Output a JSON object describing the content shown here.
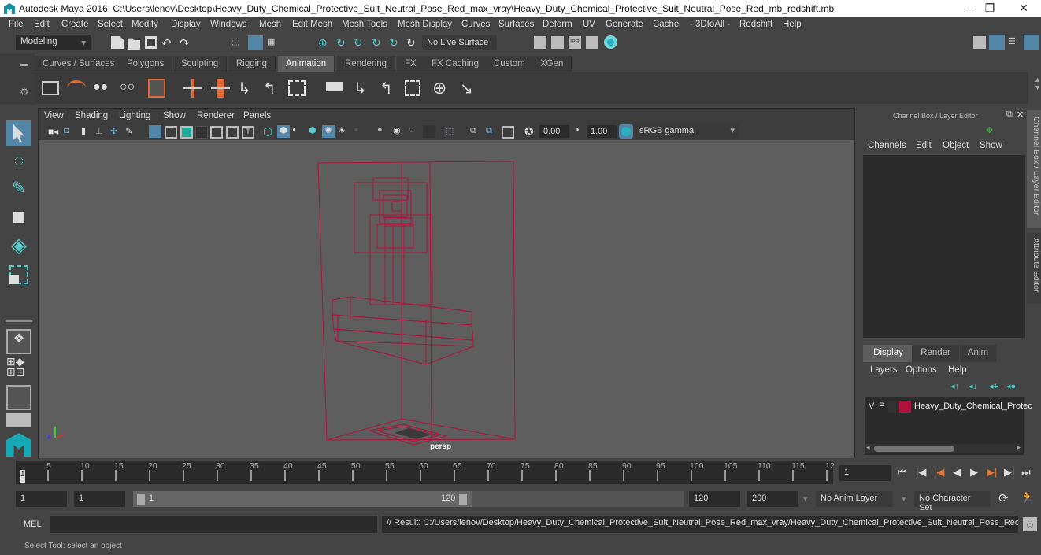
{
  "window": {
    "title": "Autodesk Maya 2016: C:\\Users\\lenov\\Desktop\\Heavy_Duty_Chemical_Protective_Suit_Neutral_Pose_Red_max_vray\\Heavy_Duty_Chemical_Protective_Suit_Neutral_Pose_Red_mb_redshift.mb",
    "minimize": "—",
    "restore": "❐",
    "close": "✕"
  },
  "menubar": [
    "File",
    "Edit",
    "Create",
    "Select",
    "Modify",
    "Display",
    "Windows",
    "Mesh",
    "Edit Mesh",
    "Mesh Tools",
    "Mesh Display",
    "Curves",
    "Surfaces",
    "Deform",
    "UV",
    "Generate",
    "Cache",
    "- 3DtoAll -",
    "Redshift",
    "Help"
  ],
  "statusbar": {
    "mode": "Modeling",
    "live_surface": "No Live Surface"
  },
  "shelf_tabs": [
    {
      "label": "Curves / Surfaces"
    },
    {
      "label": "Polygons"
    },
    {
      "label": "Sculpting"
    },
    {
      "label": "Rigging"
    },
    {
      "label": "Animation",
      "active": true
    },
    {
      "label": "Rendering"
    },
    {
      "label": "FX"
    },
    {
      "label": "FX Caching"
    },
    {
      "label": "Custom"
    },
    {
      "label": "XGen"
    }
  ],
  "viewport": {
    "menu": [
      "View",
      "Shading",
      "Lighting",
      "Show",
      "Renderer",
      "Panels"
    ],
    "exposure": "0.00",
    "gamma": "1.00",
    "color_space": "sRGB gamma",
    "camera_label": "persp",
    "wire_color": "#b0123a"
  },
  "channel_box": {
    "title": "Channel Box / Layer Editor",
    "menu": [
      "Channels",
      "Edit",
      "Object",
      "Show"
    ]
  },
  "layer_editor": {
    "tabs": [
      "Display",
      "Render",
      "Anim"
    ],
    "active_tab": "Display",
    "menu": [
      "Layers",
      "Options",
      "Help"
    ],
    "layers": [
      {
        "v": "V",
        "p": "P",
        "color": "#b0123a",
        "name": "Heavy_Duty_Chemical_Protec"
      }
    ]
  },
  "side_tabs": [
    "Channel Box / Layer Editor",
    "Attribute Editor"
  ],
  "timeline": {
    "ticks": [
      "5",
      "10",
      "15",
      "20",
      "25",
      "30",
      "35",
      "40",
      "45",
      "50",
      "55",
      "60",
      "65",
      "70",
      "75",
      "80",
      "85",
      "90",
      "95",
      "100",
      "105",
      "110",
      "115",
      "12"
    ],
    "current_frame_marker": "1",
    "current_frame": "1"
  },
  "range": {
    "start": "1",
    "playback_start": "1",
    "slider_start": "1",
    "slider_end": "120",
    "playback_end": "120",
    "end": "200",
    "anim_layer": "No Anim Layer",
    "character_set": "No Character Set"
  },
  "command_line": {
    "label": "MEL",
    "input": "",
    "result": "// Result: C:/Users/lenov/Desktop/Heavy_Duty_Chemical_Protective_Suit_Neutral_Pose_Red_max_vray/Heavy_Duty_Chemical_Protective_Suit_Neutral_Pose_Red_mb_"
  },
  "help_line": "Select Tool: select an object"
}
